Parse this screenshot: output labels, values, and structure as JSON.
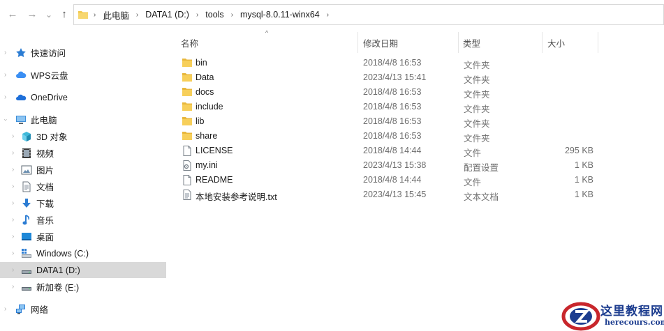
{
  "nav": {
    "back_glyph": "←",
    "forward_glyph": "→",
    "recent_glyph": "⌄",
    "up_glyph": "↑"
  },
  "breadcrumb": {
    "items": [
      "此电脑",
      "DATA1 (D:)",
      "tools",
      "mysql-8.0.11-winx64"
    ],
    "separator": "›"
  },
  "sidebar": {
    "items": [
      {
        "label": "快速访问",
        "icon": "star-icon"
      },
      {
        "label": "WPS云盘",
        "icon": "cloud-icon"
      },
      {
        "label": "OneDrive",
        "icon": "onedrive-icon"
      },
      {
        "label": "此电脑",
        "icon": "computer-icon"
      },
      {
        "label": "3D 对象",
        "icon": "cube-icon"
      },
      {
        "label": "视频",
        "icon": "video-icon"
      },
      {
        "label": "图片",
        "icon": "picture-icon"
      },
      {
        "label": "文档",
        "icon": "document-icon"
      },
      {
        "label": "下载",
        "icon": "download-icon"
      },
      {
        "label": "音乐",
        "icon": "music-icon"
      },
      {
        "label": "桌面",
        "icon": "desktop-icon"
      },
      {
        "label": "Windows (C:)",
        "icon": "windows-drive-icon"
      },
      {
        "label": "DATA1 (D:)",
        "icon": "drive-icon"
      },
      {
        "label": "新加卷 (E:)",
        "icon": "drive-icon"
      },
      {
        "label": "网络",
        "icon": "network-icon"
      }
    ],
    "selected": "DATA1 (D:)"
  },
  "columns": {
    "name": "名称",
    "date": "修改日期",
    "type": "类型",
    "size": "大小"
  },
  "files": [
    {
      "name": "bin",
      "date": "2018/4/8 16:53",
      "type": "文件夹",
      "size": "",
      "kind": "folder"
    },
    {
      "name": "Data",
      "date": "2023/4/13 15:41",
      "type": "文件夹",
      "size": "",
      "kind": "folder"
    },
    {
      "name": "docs",
      "date": "2018/4/8 16:53",
      "type": "文件夹",
      "size": "",
      "kind": "folder"
    },
    {
      "name": "include",
      "date": "2018/4/8 16:53",
      "type": "文件夹",
      "size": "",
      "kind": "folder"
    },
    {
      "name": "lib",
      "date": "2018/4/8 16:53",
      "type": "文件夹",
      "size": "",
      "kind": "folder"
    },
    {
      "name": "share",
      "date": "2018/4/8 16:53",
      "type": "文件夹",
      "size": "",
      "kind": "folder"
    },
    {
      "name": "LICENSE",
      "date": "2018/4/8 14:44",
      "type": "文件",
      "size": "295 KB",
      "kind": "file"
    },
    {
      "name": "my.ini",
      "date": "2023/4/13 15:38",
      "type": "配置设置",
      "size": "1 KB",
      "kind": "ini"
    },
    {
      "name": "README",
      "date": "2018/4/8 14:44",
      "type": "文件",
      "size": "1 KB",
      "kind": "file"
    },
    {
      "name": "本地安装参考说明.txt",
      "date": "2023/4/13 15:45",
      "type": "文本文档",
      "size": "1 KB",
      "kind": "txt"
    }
  ],
  "watermark": {
    "title": "这里教程网",
    "subtitle": "herecours.com"
  },
  "colors": {
    "folder": "#f2c94c",
    "selection": "#d9d9d9",
    "watermark": "#1d3d8f"
  }
}
